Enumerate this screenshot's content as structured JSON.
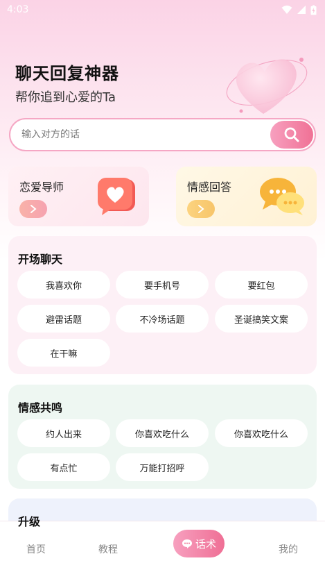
{
  "status": {
    "time": "4:03"
  },
  "hero": {
    "title": "聊天回复神器",
    "subtitle": "帮你追到心爱的Ta"
  },
  "search": {
    "placeholder": "输入对方的话"
  },
  "features": [
    {
      "label": "恋爱导师"
    },
    {
      "label": "情感回答"
    }
  ],
  "sections": [
    {
      "title": "开场聊天",
      "tags": [
        "我喜欢你",
        "要手机号",
        "要红包",
        "避雷话题",
        "不冷场话题",
        "圣诞搞笑文案",
        "在干嘛"
      ]
    },
    {
      "title": "情感共鸣",
      "tags": [
        "约人出来",
        "你喜欢吃什么",
        "你喜欢吃什么",
        "有点忙",
        "万能打招呼"
      ]
    },
    {
      "title": "升级"
    }
  ],
  "tabbar": {
    "home": "首页",
    "tutorial": "教程",
    "scripts": "话术",
    "mine": "我的"
  }
}
